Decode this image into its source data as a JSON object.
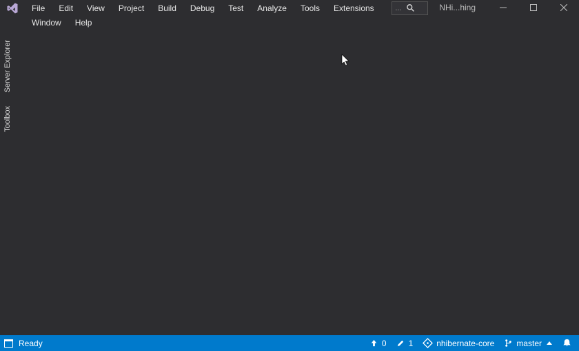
{
  "menus": {
    "file": "File",
    "edit": "Edit",
    "view": "View",
    "project": "Project",
    "build": "Build",
    "debug": "Debug",
    "test": "Test",
    "analyze": "Analyze",
    "tools": "Tools",
    "extensions": "Extensions",
    "window": "Window",
    "help": "Help"
  },
  "quicklaunch": {
    "ellipsis": "...",
    "placeholder": "Search"
  },
  "window_title": "NHi...hing",
  "side_tabs": {
    "server_explorer": "Server Explorer",
    "toolbox": "Toolbox"
  },
  "status": {
    "ready": "Ready",
    "push_count": "0",
    "pending_edits": "1",
    "repo": "nhibernate-core",
    "branch": "master"
  },
  "colors": {
    "statusbar": "#007acc",
    "background": "#2d2d30"
  }
}
